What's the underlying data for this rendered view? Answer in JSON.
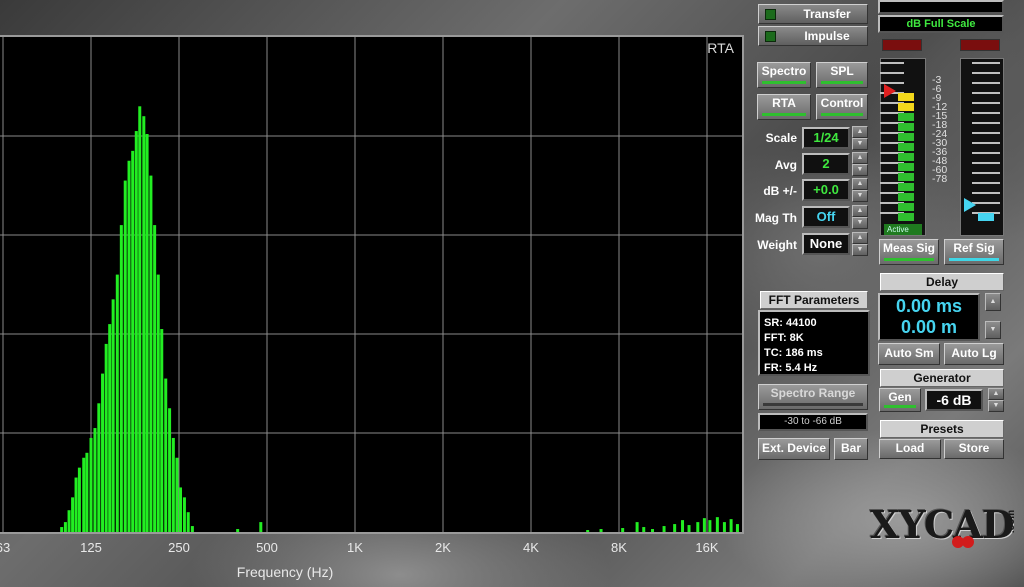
{
  "plot": {
    "corner_label": "RTA",
    "x_ticks": [
      "63",
      "125",
      "250",
      "500",
      "1K",
      "2K",
      "4K",
      "8K",
      "16K"
    ],
    "x_label": "Frequency (Hz)",
    "trace_color": "#22ee22",
    "grid_color": "#8a8a8a"
  },
  "chart_data": {
    "type": "bar",
    "title": "",
    "xlabel": "Frequency (Hz)",
    "ylabel": "",
    "x_scale": "log",
    "xlim": [
      63,
      22000
    ],
    "ylim": [
      0,
      5
    ],
    "bins": [
      {
        "f": 100,
        "v": 0.05
      },
      {
        "f": 103,
        "v": 0.1
      },
      {
        "f": 106,
        "v": 0.22
      },
      {
        "f": 109,
        "v": 0.35
      },
      {
        "f": 112,
        "v": 0.55
      },
      {
        "f": 115,
        "v": 0.65
      },
      {
        "f": 119,
        "v": 0.75
      },
      {
        "f": 122,
        "v": 0.8
      },
      {
        "f": 126,
        "v": 0.95
      },
      {
        "f": 130,
        "v": 1.05
      },
      {
        "f": 134,
        "v": 1.3
      },
      {
        "f": 138,
        "v": 1.6
      },
      {
        "f": 142,
        "v": 1.9
      },
      {
        "f": 146,
        "v": 2.1
      },
      {
        "f": 150,
        "v": 2.35
      },
      {
        "f": 155,
        "v": 2.6
      },
      {
        "f": 160,
        "v": 3.1
      },
      {
        "f": 165,
        "v": 3.55
      },
      {
        "f": 170,
        "v": 3.75
      },
      {
        "f": 175,
        "v": 3.85
      },
      {
        "f": 180,
        "v": 4.05
      },
      {
        "f": 185,
        "v": 4.3
      },
      {
        "f": 191,
        "v": 4.2
      },
      {
        "f": 196,
        "v": 4.02
      },
      {
        "f": 202,
        "v": 3.6
      },
      {
        "f": 208,
        "v": 3.1
      },
      {
        "f": 214,
        "v": 2.6
      },
      {
        "f": 220,
        "v": 2.05
      },
      {
        "f": 227,
        "v": 1.55
      },
      {
        "f": 234,
        "v": 1.25
      },
      {
        "f": 241,
        "v": 0.95
      },
      {
        "f": 248,
        "v": 0.75
      },
      {
        "f": 255,
        "v": 0.45
      },
      {
        "f": 263,
        "v": 0.35
      },
      {
        "f": 271,
        "v": 0.2
      },
      {
        "f": 280,
        "v": 0.06
      },
      {
        "f": 400,
        "v": 0.03
      },
      {
        "f": 480,
        "v": 0.1
      },
      {
        "f": 6300,
        "v": 0.02
      },
      {
        "f": 7000,
        "v": 0.03
      },
      {
        "f": 8300,
        "v": 0.04
      },
      {
        "f": 9300,
        "v": 0.1
      },
      {
        "f": 9800,
        "v": 0.05
      },
      {
        "f": 10500,
        "v": 0.03
      },
      {
        "f": 11500,
        "v": 0.06
      },
      {
        "f": 12500,
        "v": 0.08
      },
      {
        "f": 13300,
        "v": 0.12
      },
      {
        "f": 14000,
        "v": 0.07
      },
      {
        "f": 15000,
        "v": 0.1
      },
      {
        "f": 15800,
        "v": 0.14
      },
      {
        "f": 16500,
        "v": 0.12
      },
      {
        "f": 17500,
        "v": 0.15
      },
      {
        "f": 18500,
        "v": 0.1
      },
      {
        "f": 19500,
        "v": 0.13
      },
      {
        "f": 20500,
        "v": 0.08
      },
      {
        "f": 21500,
        "v": 0.1
      }
    ]
  },
  "panel": {
    "top_readout": "dB Full Scale",
    "modes": [
      {
        "label": "Transfer"
      },
      {
        "label": "Impulse"
      }
    ],
    "view_buttons": {
      "spectro": "Spectro",
      "spl": "SPL",
      "rta": "RTA",
      "control": "Control"
    },
    "rows": [
      {
        "label": "Scale",
        "value": "1/24"
      },
      {
        "label": "Avg",
        "value": "2"
      },
      {
        "label": "dB +/-",
        "value": "+0.0"
      },
      {
        "label": "Mag Th",
        "value": "Off"
      },
      {
        "label": "Weight",
        "value": "None"
      }
    ],
    "fft": {
      "title": "FFT Parameters",
      "sr": "SR: 44100",
      "fft": "FFT: 8K",
      "tc": "TC: 186 ms",
      "fr": "FR: 5.4 Hz"
    },
    "spectro_range": {
      "label": "Spectro Range",
      "value": "-30 to -66 dB"
    },
    "ext_device": "Ext. Device",
    "bar": "Bar",
    "meter": {
      "scale": [
        "-3",
        "-6",
        "-9",
        "-12",
        "-15",
        "-18",
        "-24",
        "-30",
        "-36",
        "-48",
        "-60",
        "-78"
      ],
      "active_label": "Active",
      "meas_level": 0.8,
      "ref_level": 0.08
    },
    "meas_sig": "Meas Sig",
    "ref_sig": "Ref Sig",
    "delay": {
      "title": "Delay",
      "ms": "0.00 ms",
      "m": "0.00 m"
    },
    "auto_sm": "Auto Sm",
    "auto_lg": "Auto Lg",
    "generator": {
      "title": "Generator",
      "gen": "Gen",
      "level": "-6 dB"
    },
    "presets": {
      "title": "Presets",
      "load": "Load",
      "store": "Store"
    },
    "logo": "XYCAD",
    "logo_suffix": ".com",
    "colors": {
      "green": "#2fbf2f",
      "cyan": "#46d4f0",
      "clip": "#7a0e0e",
      "yellow": "#f3d81c"
    }
  }
}
